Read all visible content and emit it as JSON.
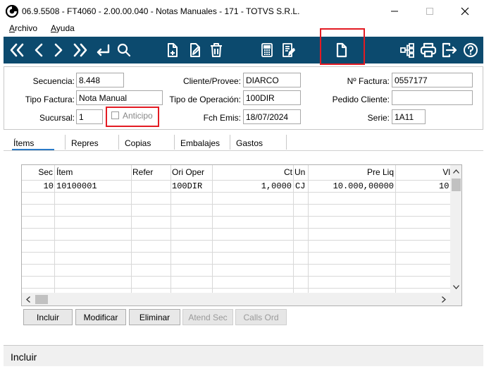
{
  "window": {
    "title": "06.9.5508 - FT4060 - 2.00.00.040 - Notas Manuales - 171 - TOTVS S.R.L.",
    "controls": [
      "minimize",
      "maximize",
      "close"
    ]
  },
  "menu": {
    "items": [
      {
        "label": "Archivo",
        "mnemonic": "A",
        "rest": "rchivo"
      },
      {
        "label": "Ayuda",
        "mnemonic": "A",
        "rest": "yuda"
      }
    ]
  },
  "toolbar": {
    "background": "#0c4a6e",
    "icons": [
      "first-record-icon",
      "previous-record-icon",
      "next-record-icon",
      "last-record-icon",
      "return-icon",
      "search-icon",
      "new-document-icon",
      "edit-document-icon",
      "delete-icon",
      "calculator-icon",
      "report-icon",
      "new-blank-icon",
      "hierarchy-icon",
      "print-icon",
      "exit-icon",
      "help-icon"
    ]
  },
  "form": {
    "secuencia_label": "Secuencia:",
    "secuencia_value": "8.448",
    "cliente_label": "Cliente/Provee:",
    "cliente_value": "DIARCO",
    "nfactura_label": "Nº Factura:",
    "nfactura_value": "0557177",
    "tipo_factura_label": "Tipo Factura:",
    "tipo_factura_value": "Nota Manual",
    "tipo_operacion_label": "Tipo de Operación:",
    "tipo_operacion_value": "100DIR",
    "pedido_label": "Pedido Cliente:",
    "pedido_value": "",
    "sucursal_label": "Sucursal:",
    "sucursal_value": "1",
    "anticipo_label": "Anticipo",
    "anticipo_checked": false,
    "fch_emis_label": "Fch Emis:",
    "fch_emis_value": "18/07/2024",
    "serie_label": "Serie:",
    "serie_value": "1A11"
  },
  "tabs": [
    {
      "label": "Ítems",
      "active": true
    },
    {
      "label": "Repres",
      "active": false
    },
    {
      "label": "Copias",
      "active": false
    },
    {
      "label": "Embalajes",
      "active": false
    },
    {
      "label": "Gastos",
      "active": false
    }
  ],
  "grid": {
    "headers": [
      "Sec",
      "Ítem",
      "Refer",
      "Ori Oper",
      "Ct",
      "Un",
      "Pre Liq",
      "Vl"
    ],
    "rows": [
      [
        "10",
        "10100001",
        "",
        "100DIR",
        "1,0000",
        "CJ",
        "10.000,00000",
        "10"
      ]
    ]
  },
  "buttons": {
    "incluir": "Incluir",
    "modificar": "Modificar",
    "eliminar": "Eliminar",
    "atend_sec": "Atend Sec",
    "calls_ord": "Calls Ord"
  },
  "status": {
    "text": "Incluir"
  },
  "colors": {
    "highlight": "#e31b23",
    "active_tab": "#2a7ac8"
  }
}
